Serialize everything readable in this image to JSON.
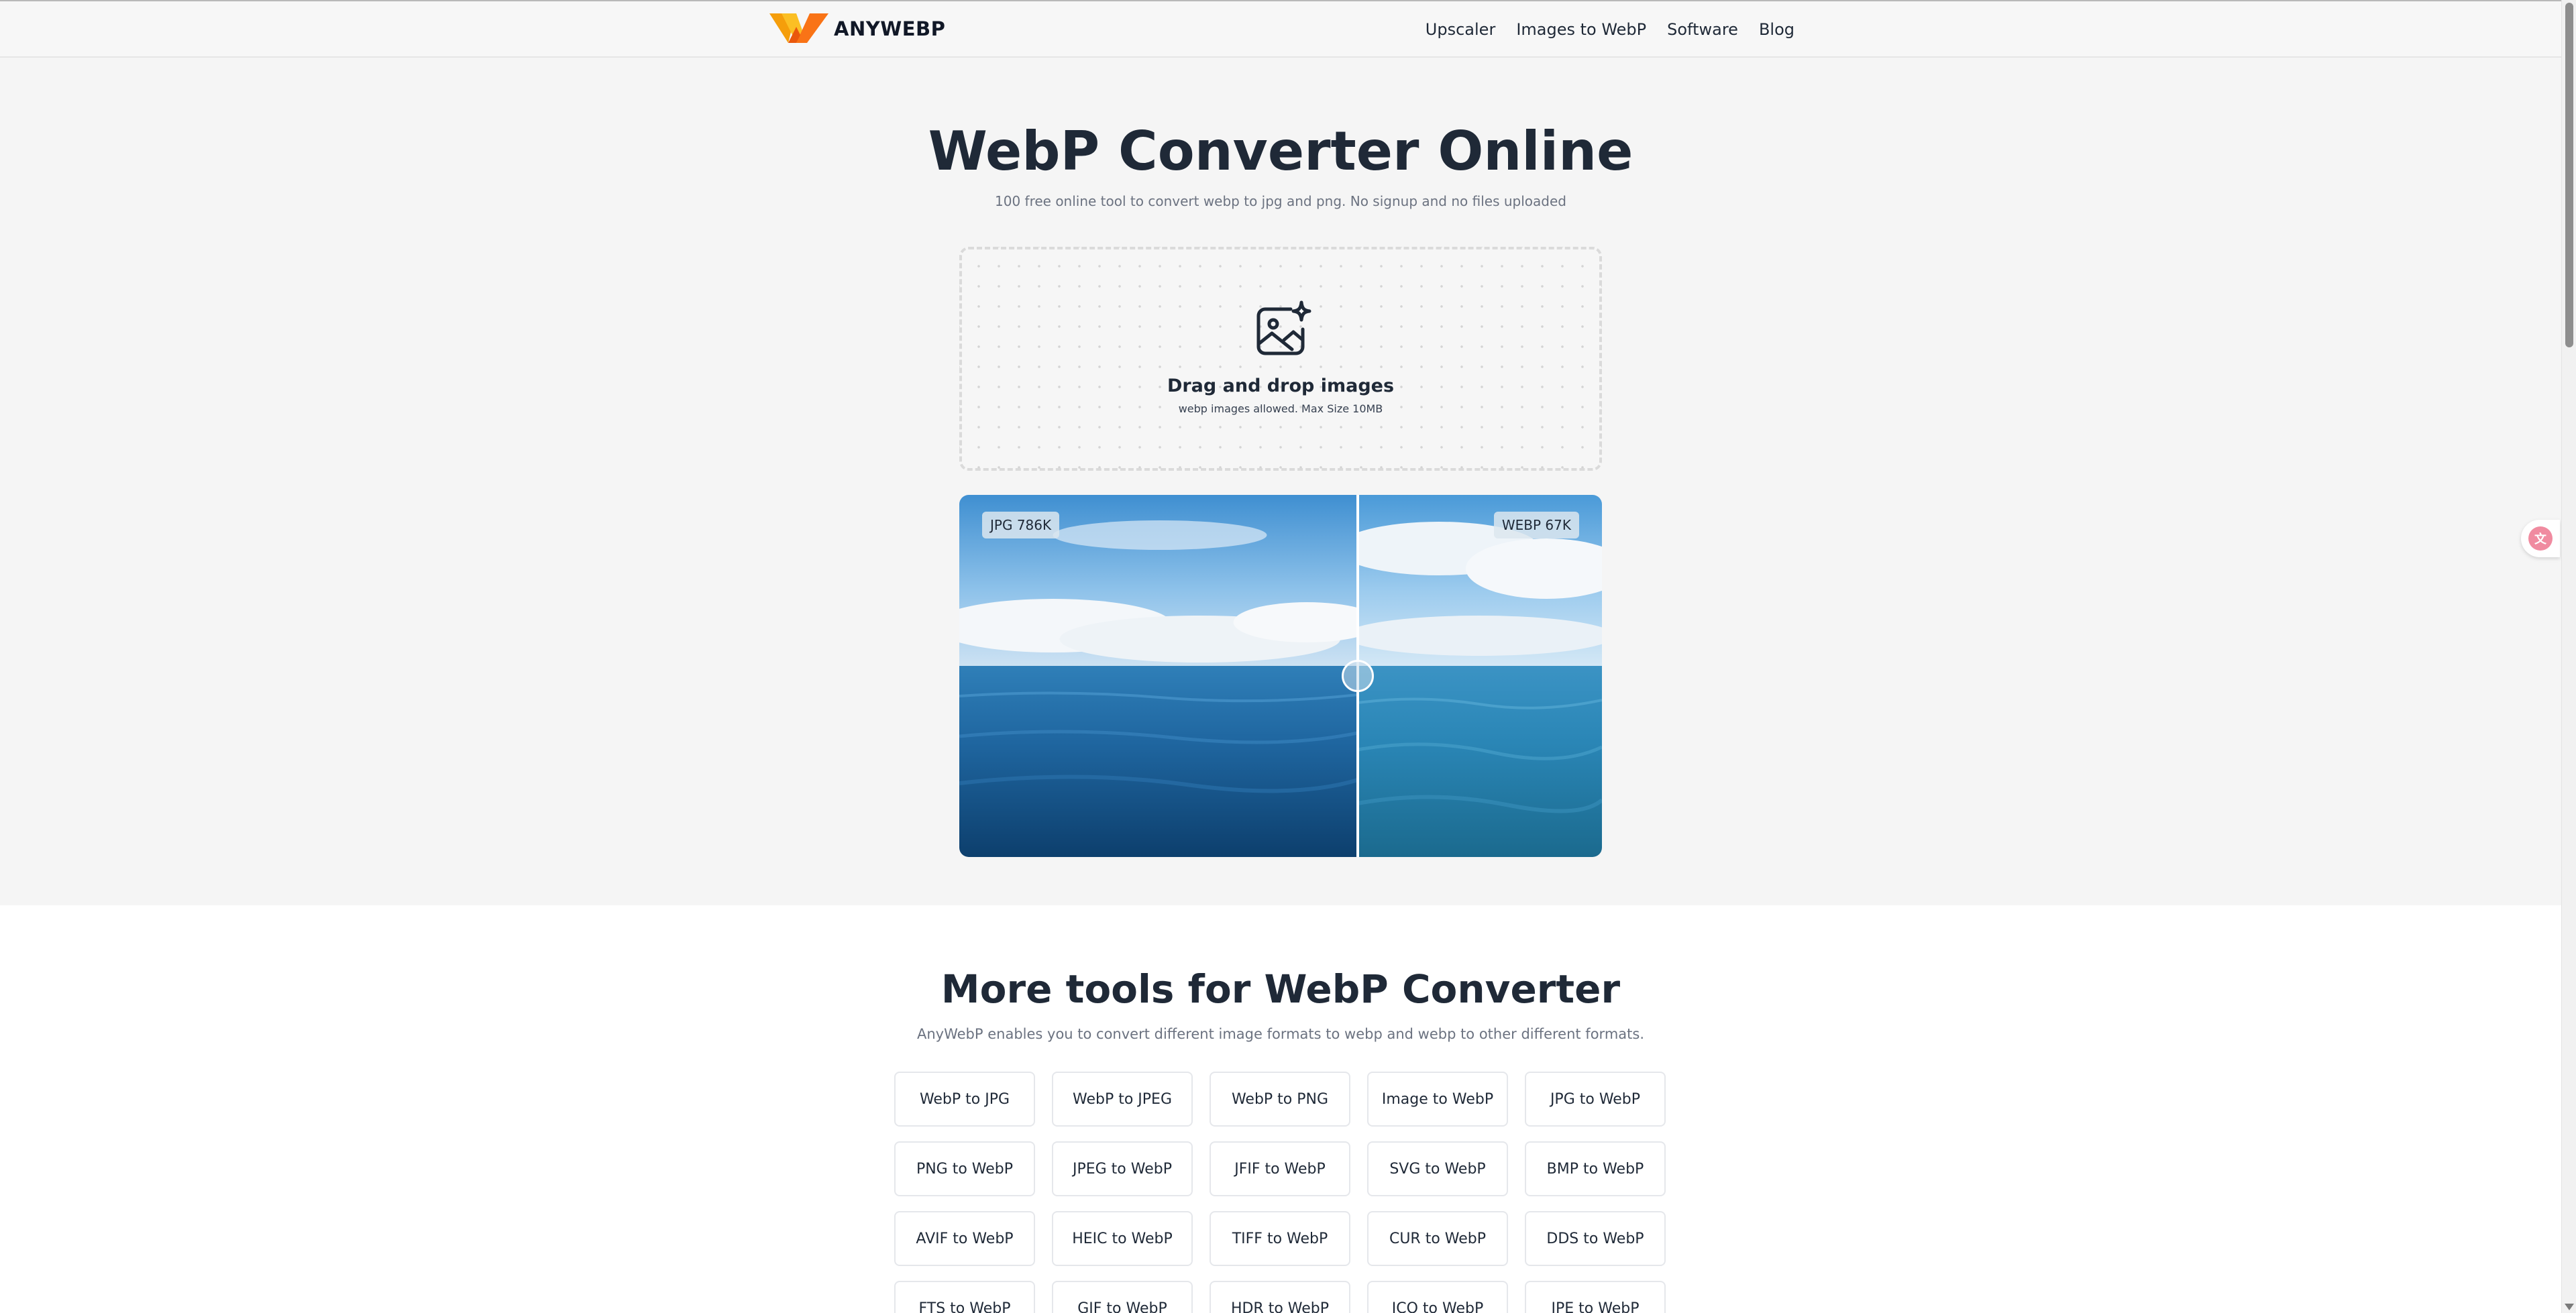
{
  "header": {
    "brand": "ANYWEBP",
    "nav": [
      {
        "label": "Upscaler"
      },
      {
        "label": "Images to WebP"
      },
      {
        "label": "Software"
      },
      {
        "label": "Blog"
      }
    ]
  },
  "hero": {
    "title": "WebP Converter Online",
    "subtitle": "100 free online tool to convert webp to jpg and png. No signup and no files uploaded"
  },
  "dropzone": {
    "title": "Drag and drop images",
    "hint": "webp images allowed. Max Size 10MB"
  },
  "compare": {
    "left_label": "JPG 786K",
    "right_label": "WEBP 67K",
    "slider_position_percent": 62
  },
  "tools": {
    "title": "More tools for WebP Converter",
    "subtitle": "AnyWebP enables you to convert different image formats to webp and webp to other different formats.",
    "items": [
      "WebP to JPG",
      "WebP to JPEG",
      "WebP to PNG",
      "Image to WebP",
      "JPG to WebP",
      "PNG to WebP",
      "JPEG to WebP",
      "JFIF to WebP",
      "SVG to WebP",
      "BMP to WebP",
      "AVIF to WebP",
      "HEIC to WebP",
      "TIFF to WebP",
      "CUR to WebP",
      "DDS to WebP",
      "FTS to WebP",
      "GIF to WebP",
      "HDR to WebP",
      "ICO to WebP",
      "JPE to WebP"
    ]
  },
  "colors": {
    "brand_orange": "#f59e0b",
    "hero_background": "#f5f5f5",
    "translate_pink": "#f08ba0"
  },
  "icons": {
    "logo": "anywebp-logo",
    "dropzone": "image-sparkle-icon",
    "translate": "translate-icon"
  }
}
